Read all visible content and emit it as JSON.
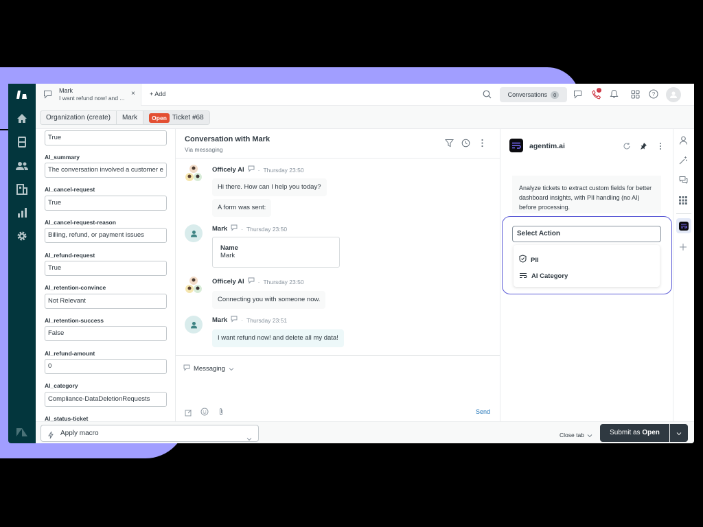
{
  "tabs": [
    {
      "name": "Mark",
      "subtitle": "I want refund now! and ..."
    }
  ],
  "add_tab_label": "+ Add",
  "header": {
    "conversations_label": "Conversations",
    "conversations_count": "0",
    "notification_badge": "!"
  },
  "breadcrumb": {
    "organization": "Organization (create)",
    "user": "Mark",
    "status": "Open",
    "ticket": "Ticket #68"
  },
  "fields": [
    {
      "label": "",
      "value": "True"
    },
    {
      "label": "AI_summary",
      "value": "The conversation involved a customer e"
    },
    {
      "label": "AI_cancel-request",
      "value": "True"
    },
    {
      "label": "AI_cancel-request-reason",
      "value": "Billing, refund, or payment issues"
    },
    {
      "label": "AI_refund-request",
      "value": "True"
    },
    {
      "label": "AI_retention-convince",
      "value": "Not Relevant"
    },
    {
      "label": "AI_retention-success",
      "value": "False"
    },
    {
      "label": "AI_refund-amount",
      "value": "0"
    },
    {
      "label": "AI_category",
      "value": "Compliance-DataDeletionRequests"
    },
    {
      "label": "AI_status-ticket",
      "value": ""
    }
  ],
  "conversation": {
    "title": "Conversation with Mark",
    "channel": "Via messaging",
    "messages": [
      {
        "author": "Officely AI",
        "time": "Thursday 23:50",
        "bubbles": [
          "Hi there. How can I help you today?",
          "A form was sent:"
        ]
      },
      {
        "author": "Mark",
        "time": "Thursday 23:50",
        "form": {
          "label": "Name",
          "value": "Mark"
        }
      },
      {
        "author": "Officely AI",
        "time": "Thursday 23:50",
        "bubbles": [
          "Connecting you with someone now."
        ]
      },
      {
        "author": "Mark",
        "time": "Thursday 23:51",
        "bubbles": [
          "I want refund now! and delete all my data!"
        ]
      }
    ],
    "dot": "·"
  },
  "composer": {
    "channel": "Messaging",
    "send_label": "Send"
  },
  "ai_panel": {
    "app_name": "agentim.ai",
    "description": "Analyze tickets to extract custom fields for better dashboard insights, with PII handling (no AI) before processing.",
    "select_placeholder": "Select Action",
    "options": [
      {
        "label": "PII",
        "icon": "shield-check-icon"
      },
      {
        "label": "AI Category",
        "icon": "wrap-lines-icon"
      }
    ]
  },
  "bottom": {
    "macro_label": "Apply macro",
    "close_tab_label": "Close tab",
    "submit_prefix": "Submit as ",
    "submit_status": "Open"
  },
  "colors": {
    "nav_bg": "#03363d",
    "accent_purple": "#a19eff",
    "open_badge": "#e34f32",
    "submit_bg": "#2f3941",
    "send_link": "#1f73b7",
    "select_outline": "#5b5bd6"
  }
}
